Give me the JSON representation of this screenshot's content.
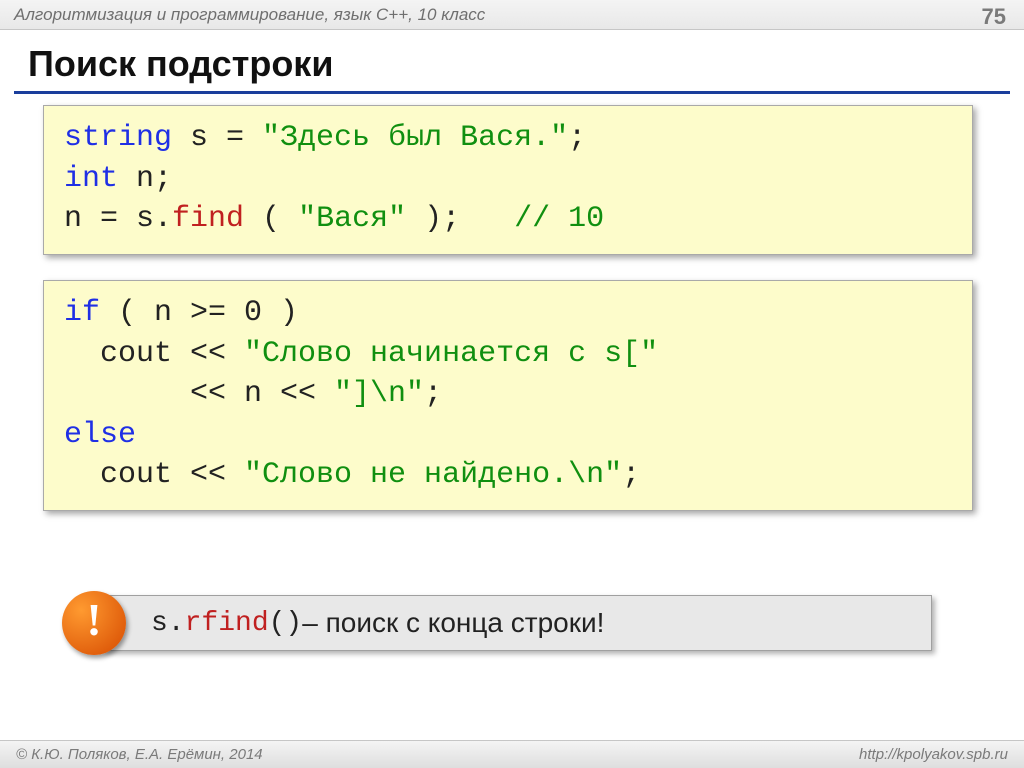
{
  "header": {
    "breadcrumb": "Алгоритмизация и программирование, язык C++, 10 класс",
    "page": "75"
  },
  "title": "Поиск подстроки",
  "code1": {
    "l1a": "string",
    "l1b": " s = ",
    "l1c": "\"Здесь был Вася.\"",
    "l1d": ";",
    "l2a": "int",
    "l2b": " n;",
    "l3a": "n = s.",
    "l3b": "find",
    "l3c": " ( ",
    "l3d": "\"Вася\"",
    "l3e": " );   ",
    "l3f": "// 10"
  },
  "code2": {
    "l1a": "if",
    "l1b": " ( n >= 0 )",
    "l2a": "  cout << ",
    "l2b": "\"Слово начинается с s[\"",
    "l3a": "       << n << ",
    "l3b": "\"]\\n\"",
    "l3c": ";",
    "l4a": "else",
    "l5a": "  cout << ",
    "l5b": "\"Слово не найдено.\\n\"",
    "l5c": ";"
  },
  "note": {
    "bang": "!",
    "mono1": "s.",
    "red": "rfind",
    "mono2": "()",
    "text": " – поиск с конца строки!"
  },
  "footer": {
    "left": "© К.Ю. Поляков, Е.А. Ерёмин, 2014",
    "right": "http://kpolyakov.spb.ru"
  }
}
